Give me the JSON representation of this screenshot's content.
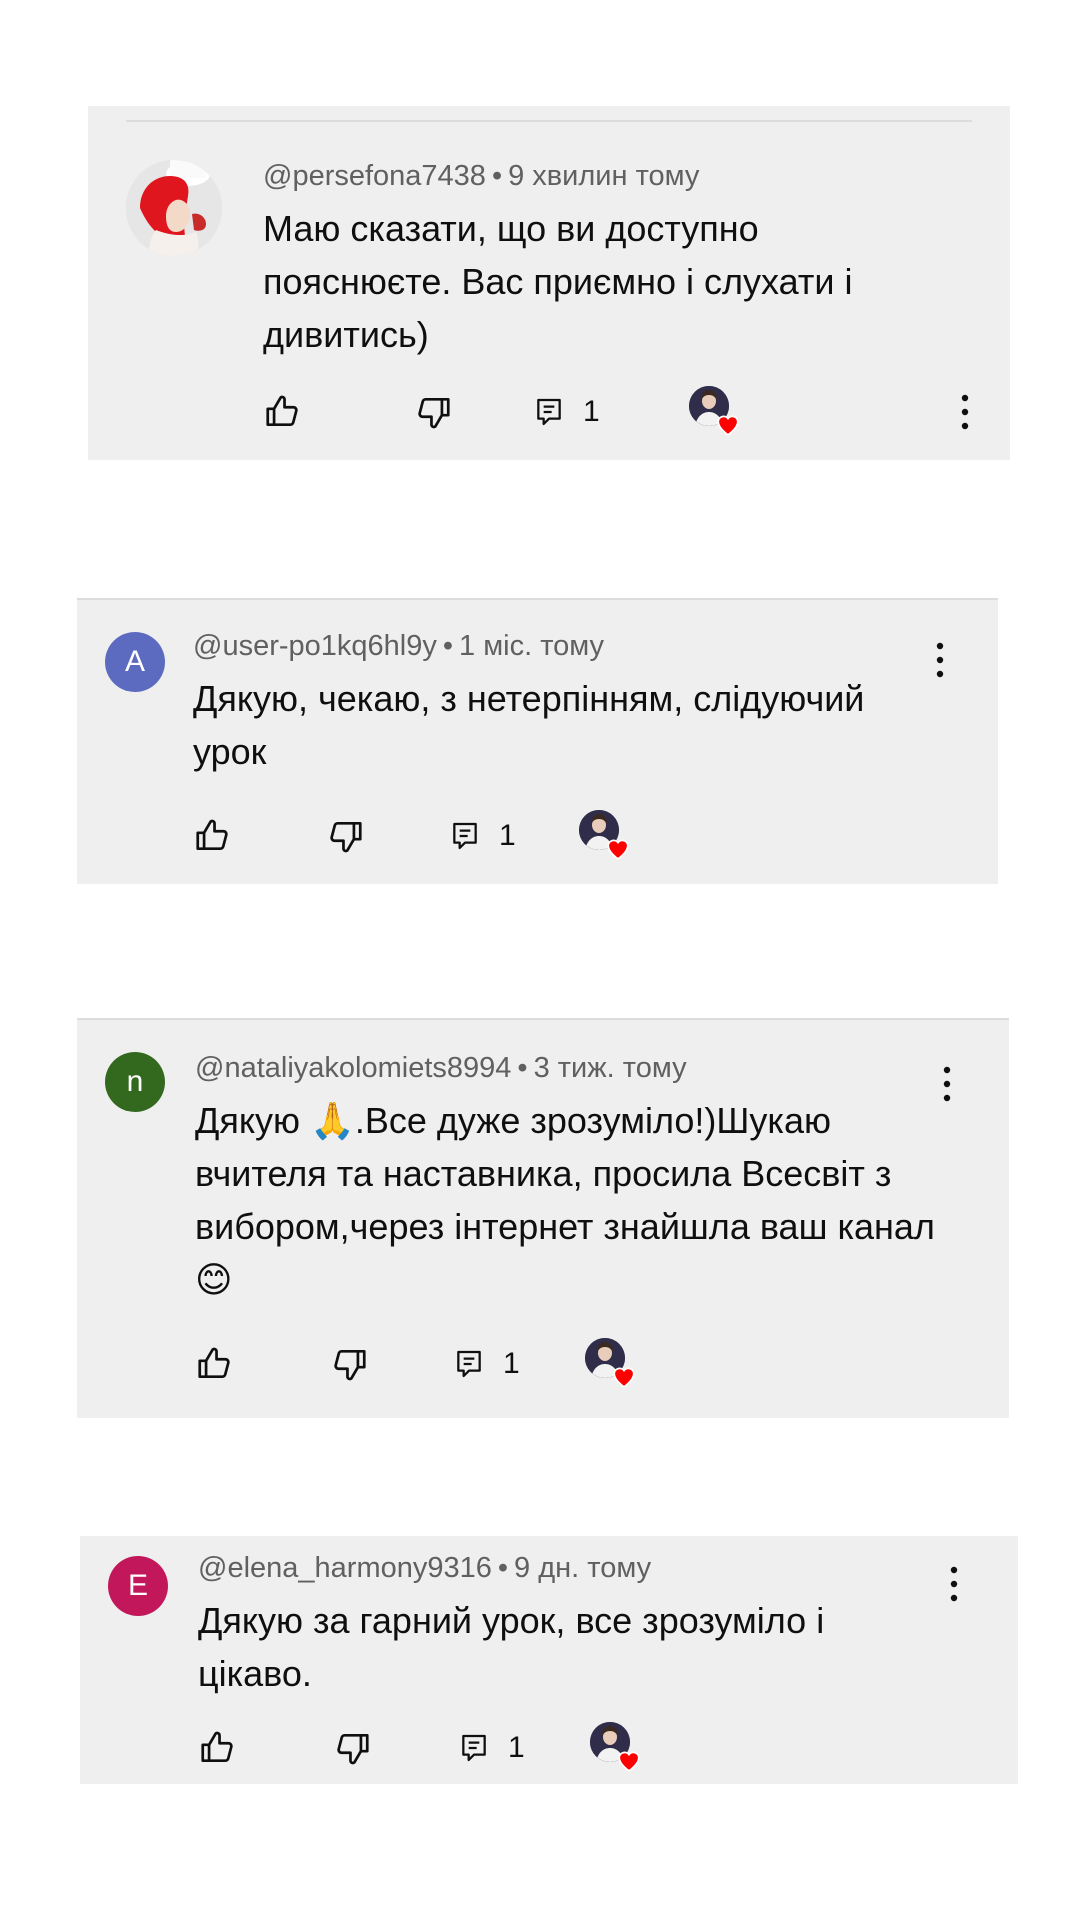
{
  "comments": [
    {
      "author": "@persefona7438",
      "separator": "•",
      "time": "9 хвилин тому",
      "text": "Маю сказати, що ви доступно пояснюєте. Вас приємно  і слухати і дивитись)",
      "reply_count": "1",
      "avatar_letter": "",
      "avatar_color": ""
    },
    {
      "author": "@user-po1kq6hl9y",
      "separator": "•",
      "time": "1 міс. тому",
      "text": "Дякую, чекаю, з нетерпінням, слідуючий урок",
      "reply_count": "1",
      "avatar_letter": "A",
      "avatar_color": "#5c6bc0"
    },
    {
      "author": "@nataliyakolomiets8994",
      "separator": "•",
      "time": "3 тиж. тому",
      "text": "Дякую 🙏.Все дуже зрозуміло!)Шукаю вчителя та наставника, просила Всесвіт з вибором,через інтернет знайшла ваш канал😊",
      "reply_count": "1",
      "avatar_letter": "n",
      "avatar_color": "#33691e"
    },
    {
      "author": "@elena_harmony9316",
      "separator": "•",
      "time": "9 дн. тому",
      "text": "Дякую за гарний урок, все зрозуміло і цікаво.",
      "reply_count": "1",
      "avatar_letter": "E",
      "avatar_color": "#c2185b"
    }
  ],
  "icons": {
    "like": "thumb-up-icon",
    "dislike": "thumb-down-icon",
    "reply": "comment-icon",
    "creator_heart": "creator-heart",
    "more": "more-vert-icon"
  },
  "colors": {
    "heart": "#ff0000",
    "card_bg": "#efefef",
    "meta": "#606060"
  }
}
